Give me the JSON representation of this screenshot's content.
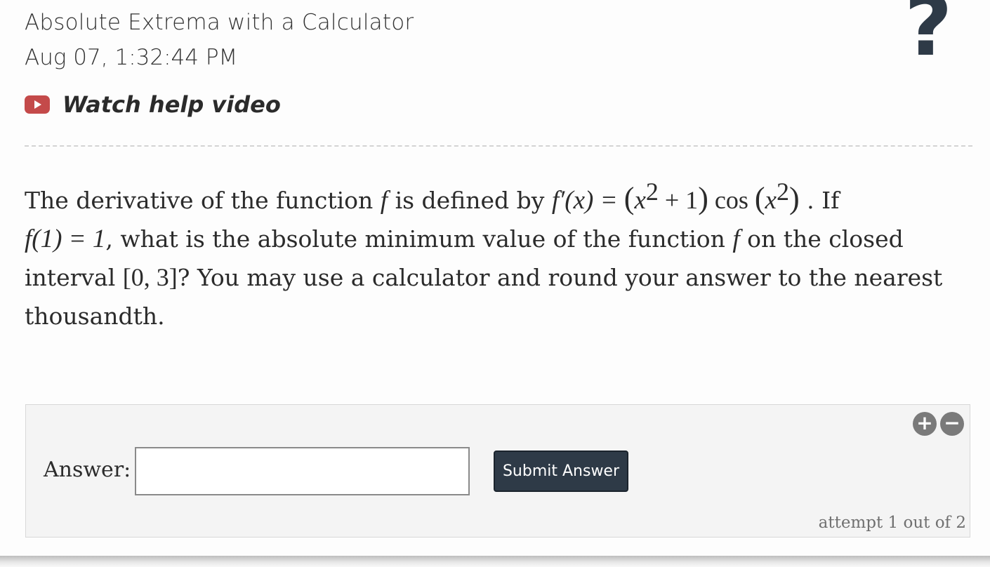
{
  "header": {
    "topic_title": "Absolute Extrema with a Calculator",
    "timestamp": "Aug 07, 1:32:44 PM",
    "help_icon": "?",
    "video_link": "Watch help video"
  },
  "question": {
    "p1": "The derivative of the function ",
    "f": "f",
    "p2": " is defined by ",
    "deriv": "f′(x) = ",
    "lparen": "(",
    "x": "x",
    "sq": "2",
    "plus1": " + 1",
    "rparen": ")",
    "cos": " cos ",
    "p3": " . If",
    "cond": "f(1) = 1",
    "p4": ", what is the absolute minimum value of the function ",
    "p5": " on the closed interval ",
    "interval": "[0, 3]",
    "p6": "? You may use a calculator and round your answer to the nearest thousandth."
  },
  "answer": {
    "label": "Answer:",
    "input_value": "",
    "submit_label": "Submit Answer",
    "zoom_in": "+",
    "zoom_out": "−",
    "attempt": "attempt 1 out of 2"
  },
  "colors": {
    "button_bg": "#2e3a47",
    "video_icon": "#c44a4a"
  }
}
